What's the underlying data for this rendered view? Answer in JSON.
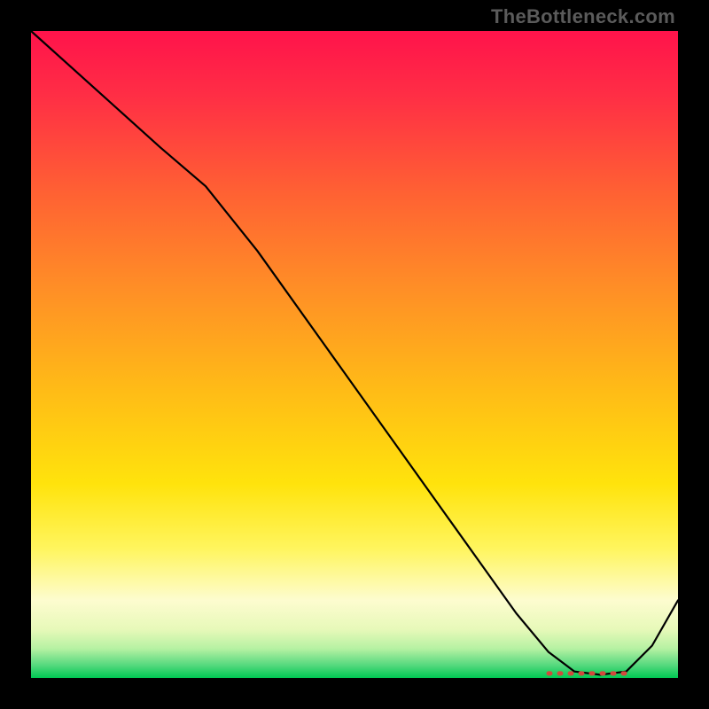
{
  "attribution": "TheBottleneck.com",
  "colors": {
    "background": "#000000",
    "curve": "#000000",
    "dash": "#d24a3c"
  },
  "chart_data": {
    "type": "line",
    "title": "",
    "xlabel": "",
    "ylabel": "",
    "xlim": [
      0,
      100
    ],
    "ylim": [
      0,
      100
    ],
    "series": [
      {
        "name": "bottleneck-curve",
        "x": [
          0,
          10,
          20,
          27,
          35,
          45,
          55,
          65,
          75,
          80,
          84,
          88,
          92,
          96,
          100
        ],
        "y": [
          100,
          91,
          82,
          76,
          66,
          52,
          38,
          24,
          10,
          4,
          1,
          0.5,
          1,
          5,
          12
        ]
      }
    ],
    "annotations": [
      {
        "name": "optimal-range-dash",
        "x_start": 80,
        "x_end": 92,
        "y": 0.7
      }
    ],
    "gradient_legend_implied": {
      "top": "high bottleneck (red)",
      "bottom": "no bottleneck (green)"
    }
  }
}
